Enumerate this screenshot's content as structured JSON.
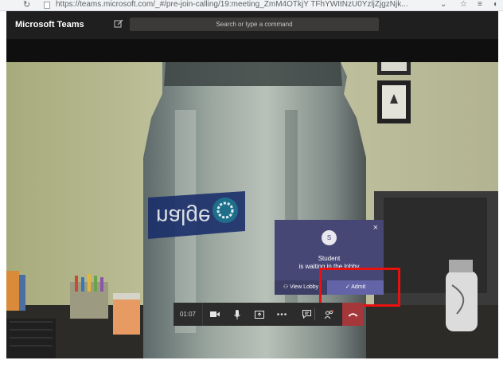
{
  "browser": {
    "url": "https://teams.microsoft.com/_#/pre-join-calling/19:meeting_ZmM4OTkjY TFhYWItNzU0YzljZjgzNjk...",
    "reload_icon": "reload-icon"
  },
  "header": {
    "app_title": "Microsoft Teams",
    "search_placeholder": "Search or type a command"
  },
  "lobby": {
    "avatar_initial": "S",
    "name": "Student",
    "status": "is waiting in the lobby",
    "view_lobby_label": "View Lobby",
    "admit_label": "Admit",
    "close_glyph": "×"
  },
  "call_bar": {
    "timer": "01:07",
    "controls": [
      "camera-icon",
      "microphone-icon",
      "share-screen-icon",
      "more-icon",
      "chat-icon",
      "participants-icon",
      "hang-up-icon"
    ]
  },
  "colors": {
    "teams_header": "#201f1f",
    "teams_purple": "#464775",
    "admit_button": "#6264a7",
    "hangup": "#a4373a",
    "highlight": "#e8110f"
  }
}
